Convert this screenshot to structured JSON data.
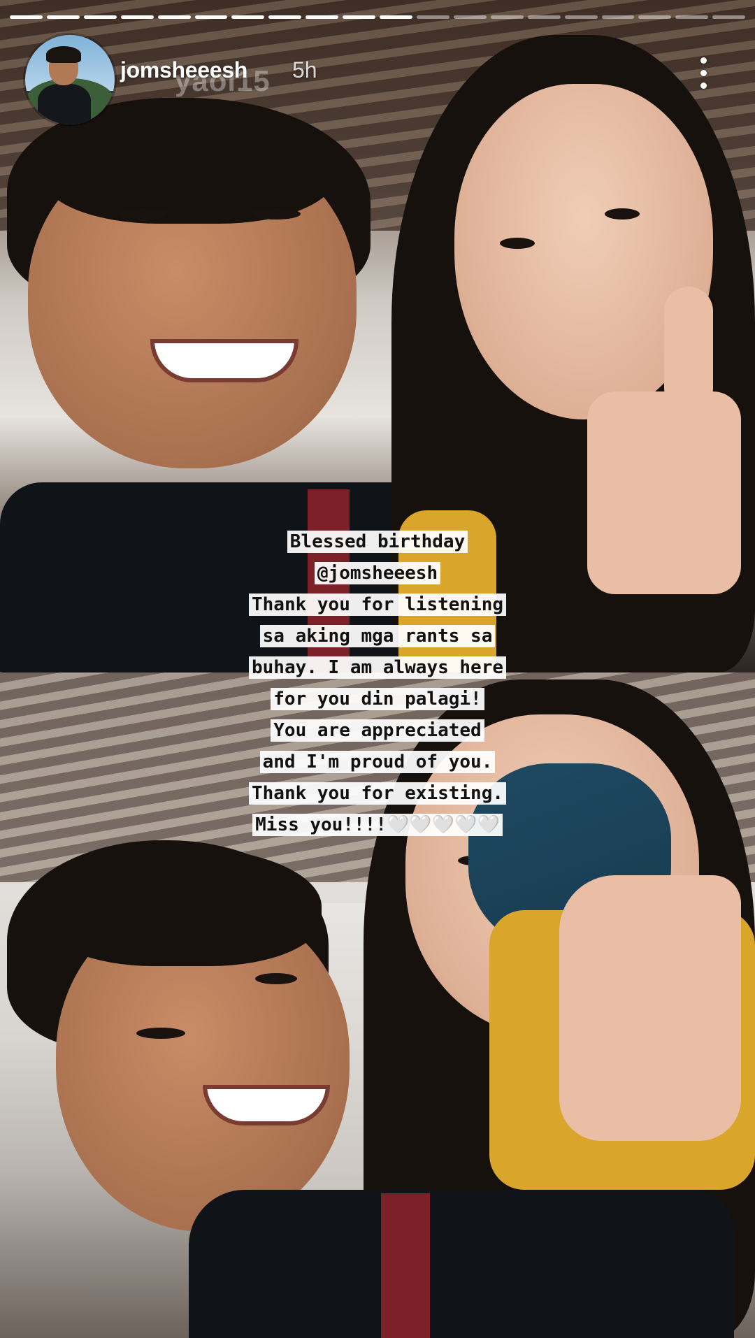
{
  "story": {
    "username": "jomsheeesh",
    "timestamp": "5h",
    "ghost_text": "yaol15",
    "progress": {
      "total_segments": 20,
      "completed_segments": 11
    }
  },
  "caption": {
    "lines": [
      "Blessed birthday",
      "@jomsheeesh",
      "Thank you for listening",
      "sa aking mga rants sa",
      "buhay. I am always here",
      "for you din palagi!",
      "You are appreciated",
      "and I'm proud of you.",
      "Thank you for existing.",
      "Miss you!!!!🤍🤍🤍🤍🤍"
    ]
  }
}
